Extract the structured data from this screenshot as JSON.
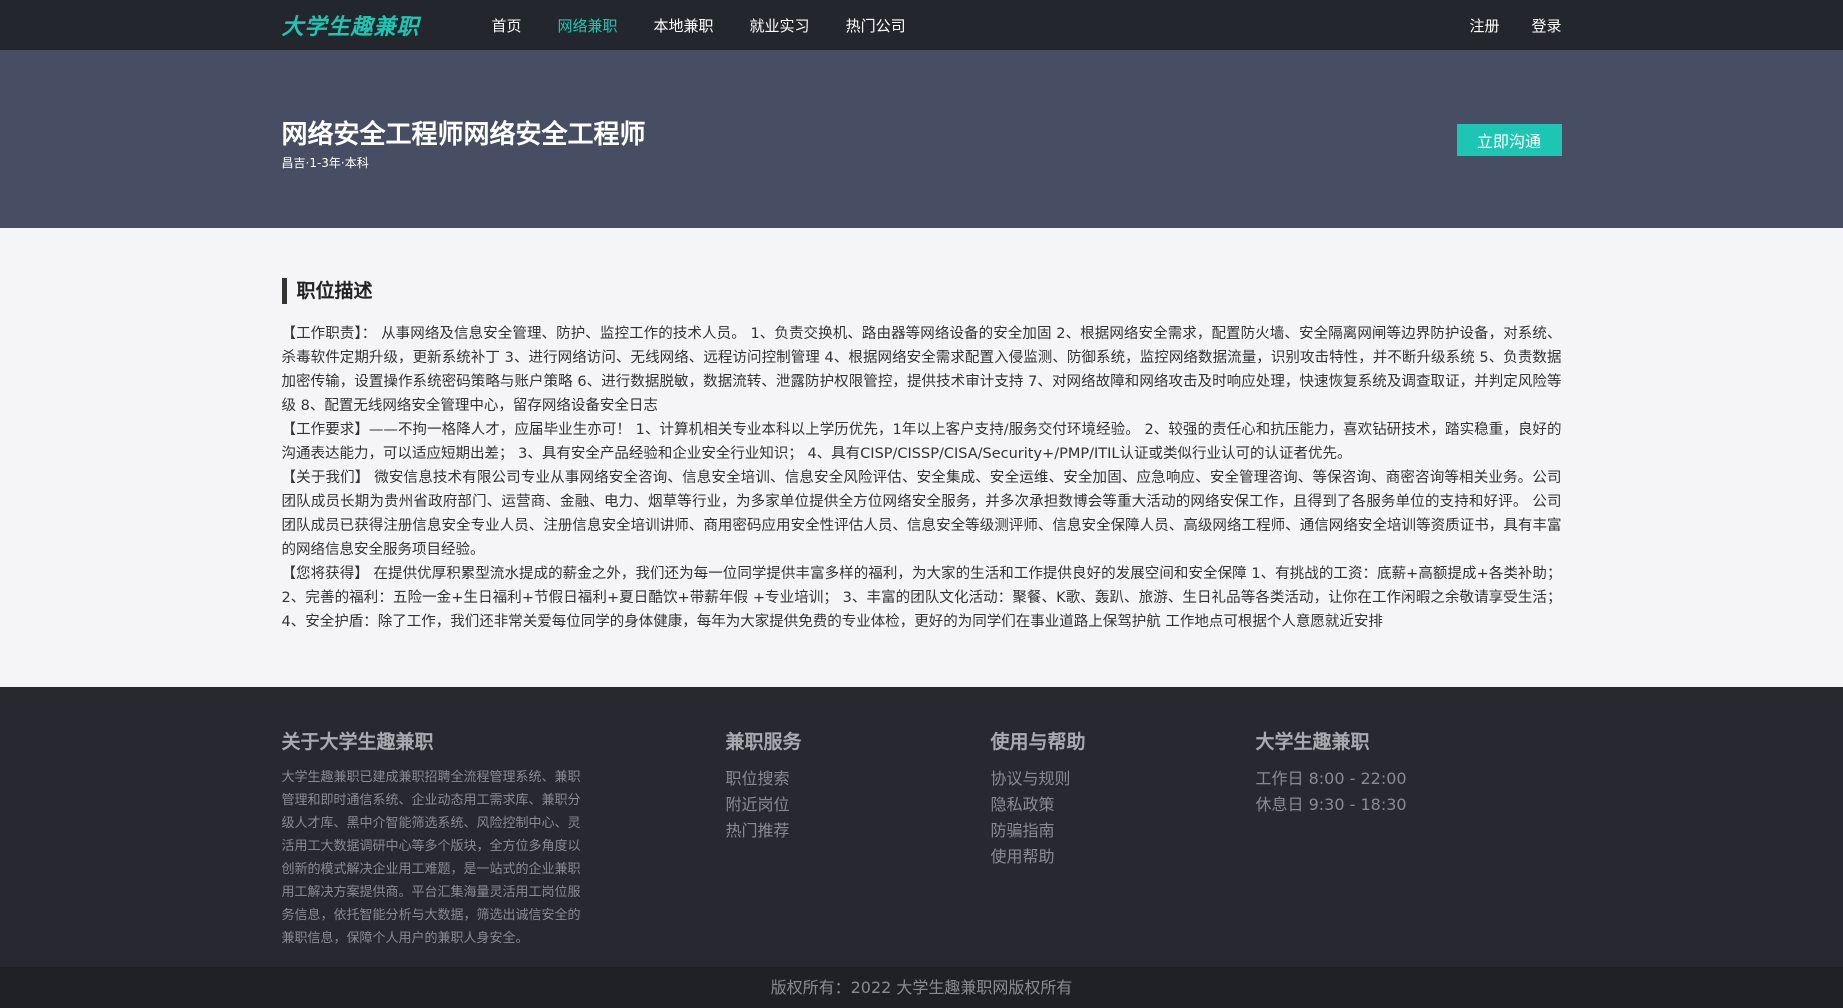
{
  "header": {
    "logo": "大学生趣兼职",
    "nav": [
      {
        "label": "首页",
        "active": false
      },
      {
        "label": "网络兼职",
        "active": true
      },
      {
        "label": "本地兼职",
        "active": false
      },
      {
        "label": "就业实习",
        "active": false
      },
      {
        "label": "热门公司",
        "active": false
      }
    ],
    "register": "注册",
    "login": "登录"
  },
  "hero": {
    "title_part1": "网络安全工程师",
    "title_part2": "网络安全工程师",
    "meta": "昌吉·1-3年·本科",
    "chat_button": "立即沟通"
  },
  "description": {
    "section_title": "职位描述",
    "paragraphs": [
      "【工作职责】： 从事网络及信息安全管理、防护、监控工作的技术人员。 1、负责交换机、路由器等网络设备的安全加固 2、根据网络安全需求，配置防火墙、安全隔离网闸等边界防护设备，对系统、杀毒软件定期升级，更新系统补丁 3、进行网络访问、无线网络、远程访问控制管理 4、根据网络安全需求配置入侵监测、防御系统，监控网络数据流量，识别攻击特性，并不断升级系统 5、负责数据加密传输，设置操作系统密码策略与账户策略 6、进行数据脱敏，数据流转、泄露防护权限管控，提供技术审计支持 7、对网络故障和网络攻击及时响应处理，快速恢复系统及调查取证，并判定风险等级 8、配置无线网络安全管理中心，留存网络设备安全日志",
      "【工作要求】——不拘一格降人才，应届毕业生亦可！ 1、计算机相关专业本科以上学历优先，1年以上客户支持/服务交付环境经验。 2、较强的责任心和抗压能力，喜欢钻研技术，踏实稳重，良好的沟通表达能力，可以适应短期出差； 3、具有安全产品经验和企业安全行业知识； 4、具有CISP/CISSP/CISA/Security+/PMP/ITIL认证或类似行业认可的认证者优先。",
      "【关于我们】 微安信息技术有限公司专业从事网络安全咨询、信息安全培训、信息安全风险评估、安全集成、安全运维、安全加固、应急响应、安全管理咨询、等保咨询、商密咨询等相关业务。公司团队成员长期为贵州省政府部门、运营商、金融、电力、烟草等行业，为多家单位提供全方位网络安全服务，并多次承担数博会等重大活动的网络安保工作，且得到了各服务单位的支持和好评。 公司团队成员已获得注册信息安全专业人员、注册信息安全培训讲师、商用密码应用安全性评估人员、信息安全等级测评师、信息安全保障人员、高级网络工程师、通信网络安全培训等资质证书，具有丰富的网络信息安全服务项目经验。",
      "【您将获得】 在提供优厚积累型流水提成的薪金之外，我们还为每一位同学提供丰富多样的福利，为大家的生活和工作提供良好的发展空间和安全保障 1、有挑战的工资：底薪+高额提成+各类补助； 2、完善的福利：五险一金+生日福利+节假日福利+夏日酷饮+带薪年假 +专业培训； 3、丰富的团队文化活动：聚餐、K歌、轰趴、旅游、生日礼品等各类活动，让你在工作闲暇之余敬请享受生活； 4、安全护盾：除了工作，我们还非常关爱每位同学的身体健康，每年为大家提供免费的专业体检，更好的为同学们在事业道路上保驾护航 工作地点可根据个人意愿就近安排"
    ]
  },
  "footer": {
    "about": {
      "title": "关于大学生趣兼职",
      "text": "大学生趣兼职已建成兼职招聘全流程管理系统、兼职管理和即时通信系统、企业动态用工需求库、兼职分级人才库、黑中介智能筛选系统、风险控制中心、灵活用工大数据调研中心等多个版块，全方位多角度以创新的模式解决企业用工难题，是一站式的企业兼职用工解决方案提供商。平台汇集海量灵活用工岗位服务信息，依托智能分析与大数据，筛选出诚信安全的兼职信息，保障个人用户的兼职人身安全。"
    },
    "services": {
      "title": "兼职服务",
      "items": [
        "职位搜索",
        "附近岗位",
        "热门推荐"
      ]
    },
    "help": {
      "title": "使用与帮助",
      "items": [
        "协议与规则",
        "隐私政策",
        "防骗指南",
        "使用帮助"
      ]
    },
    "hours": {
      "title": "大学生趣兼职",
      "items": [
        "工作日 8:00 - 22:00",
        "休息日 9:30 - 18:30"
      ]
    },
    "copyright": "版权所有：2022 大学生趣兼职网版权所有"
  },
  "colors": {
    "accent": "#1dc6b3",
    "topbar": "#24262d",
    "hero": "#474d62",
    "footer": "#282930"
  }
}
